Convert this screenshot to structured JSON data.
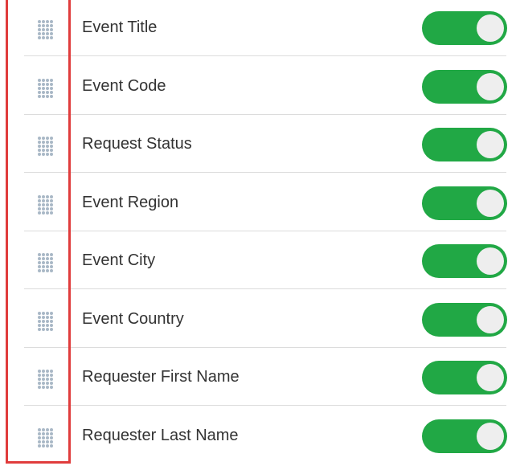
{
  "colors": {
    "toggle_on": "#21a845",
    "knob": "#eeeeee",
    "handle_dots": "#a9b8c6",
    "highlight_border": "#e03c3c",
    "divider": "#dcdcdc",
    "label_text": "#333333"
  },
  "icons": {
    "drag_handle": "drag-handle-icon"
  },
  "fields": [
    {
      "label": "Event Title",
      "enabled": true
    },
    {
      "label": "Event Code",
      "enabled": true
    },
    {
      "label": "Request Status",
      "enabled": true
    },
    {
      "label": "Event Region",
      "enabled": true
    },
    {
      "label": "Event City",
      "enabled": true
    },
    {
      "label": "Event Country",
      "enabled": true
    },
    {
      "label": "Requester First Name",
      "enabled": true
    },
    {
      "label": "Requester Last Name",
      "enabled": true
    }
  ]
}
